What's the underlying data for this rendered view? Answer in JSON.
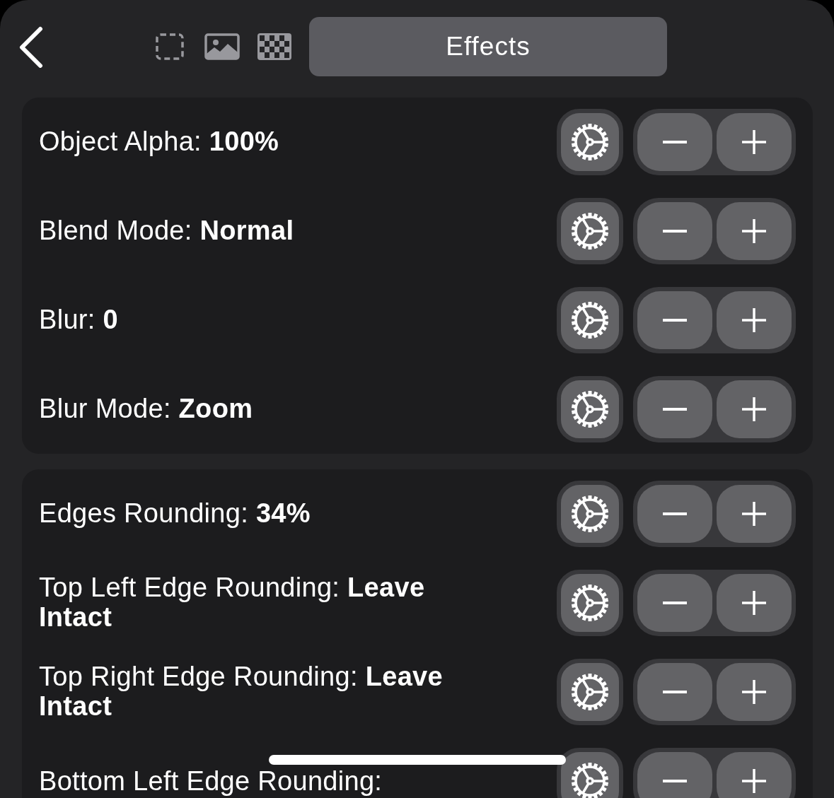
{
  "tabs": [
    {
      "kind": "icon",
      "selected": false
    },
    {
      "kind": "icon",
      "selected": false
    },
    {
      "kind": "icon",
      "selected": false
    },
    {
      "kind": "text",
      "label": "Effects",
      "selected": true
    }
  ],
  "groups": [
    {
      "rows": [
        {
          "label": "Object Alpha:",
          "value": "100%"
        },
        {
          "label": "Blend Mode:",
          "value": "Normal"
        },
        {
          "label": "Blur:",
          "value": "0"
        },
        {
          "label": "Blur Mode:",
          "value": "Zoom"
        }
      ]
    },
    {
      "rows": [
        {
          "label": "Edges Rounding:",
          "value": "34%"
        },
        {
          "label": "Top Left Edge Rounding:",
          "value": "Leave Intact"
        },
        {
          "label": "Top Right Edge Rounding:",
          "value": "Leave Intact"
        },
        {
          "label": "Bottom Left Edge Rounding:"
        }
      ]
    }
  ]
}
